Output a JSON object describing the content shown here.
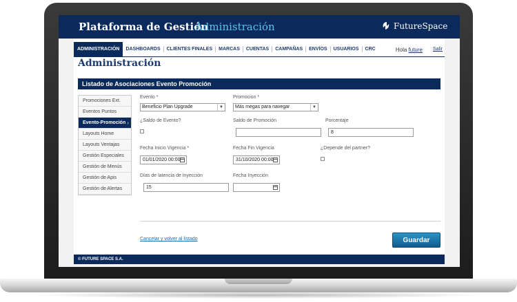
{
  "header": {
    "title": "Plataforma de Gestión",
    "subtitle": "Administración",
    "logo_text": "FutureSpace",
    "colors": {
      "topbar": "#0b2a5c",
      "subtitle": "#5bc4e8",
      "accent_button": "#1a78ab"
    }
  },
  "nav": {
    "items": [
      "ADMINISTRACIÓN",
      "DASHBOARDS",
      "CLIENTES FINALES",
      "MARCAS",
      "CUENTAS",
      "CAMPAÑAS",
      "ENVÍOS",
      "USUARIOS",
      "CRC"
    ],
    "active": "ADMINISTRACIÓN",
    "greeting": "Hola",
    "username": "future",
    "logout": "Salir"
  },
  "page_title": "Administración",
  "section_title": "Listado de Asociaciones Evento Promoción",
  "sidebar": {
    "items": [
      {
        "label": "Promociones Ext."
      },
      {
        "label": "Eventos Puntos"
      },
      {
        "label": "Evento-Promoción"
      },
      {
        "label": "Layouts Home"
      },
      {
        "label": "Layouts Ventajas"
      },
      {
        "label": "Gestión Especiales"
      },
      {
        "label": "Gestión de Menús"
      },
      {
        "label": "Gestión de Apis"
      },
      {
        "label": "Gestión de Alertas"
      }
    ],
    "active_icon": "chevron-right-icon"
  },
  "form": {
    "evento": {
      "label": "Evento *",
      "value": "Beneficio Plan Upgrade"
    },
    "promocion": {
      "label": "Promocion *",
      "value": "Más megas para navegar"
    },
    "saldo_evento": {
      "label": "¿Saldo de Evento?"
    },
    "saldo_promocion": {
      "label": "Saldo de Promoción",
      "value": ""
    },
    "porcentaje": {
      "label": "Porcentaje",
      "value": "8"
    },
    "fecha_inicio": {
      "label": "Fecha Inicio Vigencia *",
      "value": "01/01/2020 00:00"
    },
    "fecha_fin": {
      "label": "Fecha Fin Vigencia",
      "value": "31/10/2020 00:00"
    },
    "depende_partner": {
      "label": "¿Depende del partner?"
    },
    "dias_latencia": {
      "label": "Días de latencia de inyección",
      "value": "15"
    },
    "fecha_inyeccion": {
      "label": "Fecha Inyección",
      "value": ""
    }
  },
  "actions": {
    "cancel": "Cancelar y volver al listado",
    "save": "Guardar"
  },
  "footer": "© FUTURE SPACE S.A."
}
